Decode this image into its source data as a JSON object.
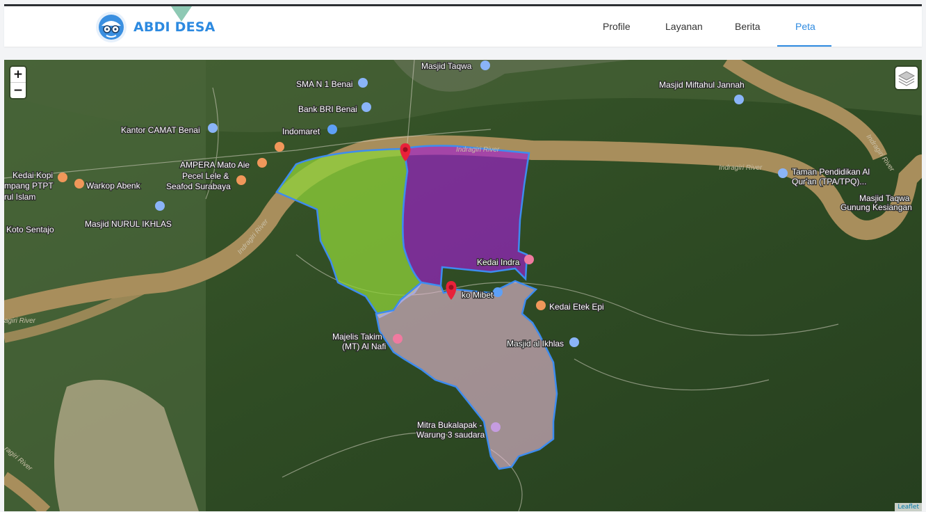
{
  "brand": {
    "name": "ABDI DESA"
  },
  "nav": {
    "items": [
      "Profile",
      "Layanan",
      "Berita",
      "Peta"
    ],
    "active": "Peta"
  },
  "map": {
    "zoom_in": "+",
    "zoom_out": "−",
    "attribution": "Leaflet",
    "places": [
      "Masjid Taqwa",
      "SMA N 1 Benai",
      "Bank BRI Benai",
      "Kantor CAMAT Benai",
      "Indomaret",
      "AMPERA Mato Aie",
      "Pecel Lele &",
      "Seafod Surabaya",
      "Warkop Abenk",
      "Kedai Kopi",
      "mpang PTPT",
      "rul Islam",
      "Masjid NURUL IKHLAS",
      "Koto Sentajo",
      "Masjid Miftahul Jannah",
      "Taman Pendidikan Al",
      "Qur'an (TPA/TPQ)...",
      "Masjid Taqwa",
      "Gunung Kesiangan",
      "Kedai Indra",
      "ko Mibet",
      "Kedai Etek Epi",
      "Majelis Takim",
      "(MT) Al Nafi",
      "Masjid al Ikhlas",
      "Mitra Bukalapak -",
      "Warung 3 saudara",
      "Indragiri River",
      "Indragiri River",
      "Indragiri River",
      "agiri River",
      "Indragiri River",
      "ragiri River"
    ]
  },
  "colors": {
    "brand": "#2d8ae0",
    "area_green": "#8fd23a",
    "area_purple": "#a21fd0",
    "area_pink": "#e8bcd6",
    "boundary": "#3d8cf0",
    "marker": "#e8213a"
  }
}
